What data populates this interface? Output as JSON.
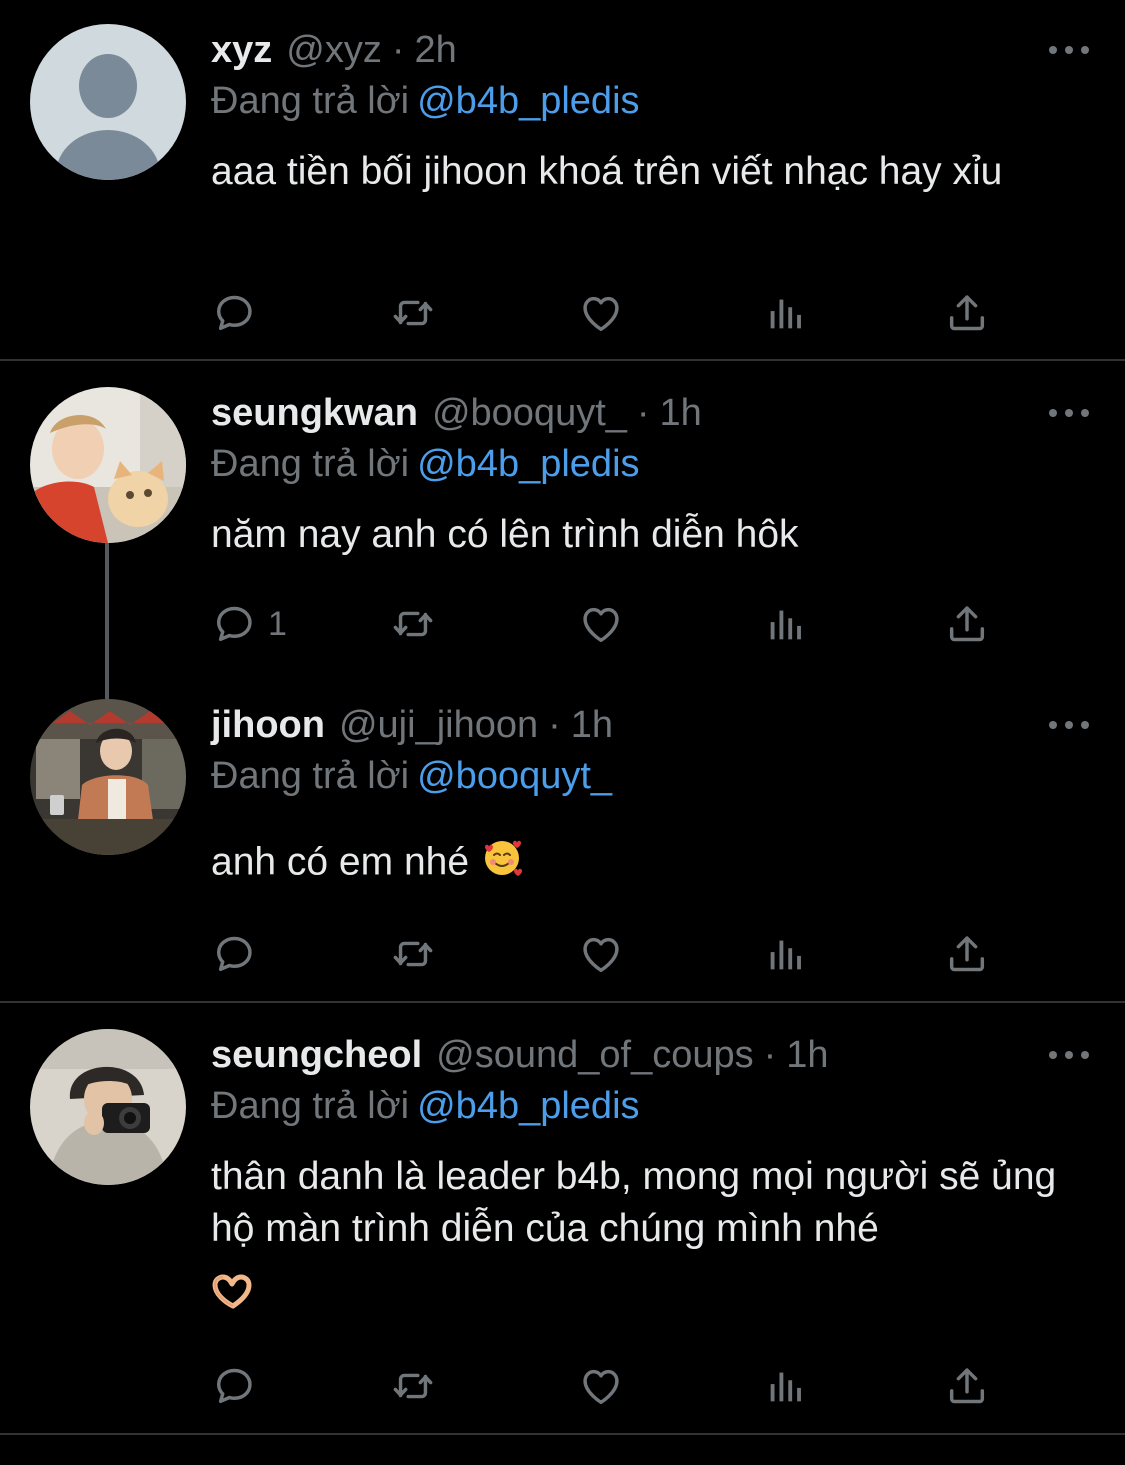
{
  "tweets": [
    {
      "name": "xyz",
      "handle": "@xyz",
      "dot": "·",
      "time": "2h",
      "reply_prefix": "Đang trả lời",
      "reply_to": "@b4b_pledis",
      "text": "aaa tiền bối jihoon khoá trên viết nhạc hay xỉu",
      "reply_count": "",
      "avatar": "default-avatar-icon"
    },
    {
      "name": "seungkwan",
      "handle": "@booquyt_",
      "dot": "·",
      "time": "1h",
      "reply_prefix": "Đang trả lời",
      "reply_to": "@b4b_pledis",
      "text": "năm nay anh có lên trình diễn hôk",
      "reply_count": "1",
      "avatar": "photo-avatar-with-cat"
    },
    {
      "name": "jihoon",
      "handle": "@uji_jihoon",
      "dot": "·",
      "time": "1h",
      "reply_prefix": "Đang trả lời",
      "reply_to": "@booquyt_",
      "text": "anh có em nhé",
      "reply_count": "",
      "emoji": "smiling-face-with-hearts-emoji",
      "avatar": "photo-avatar-room"
    },
    {
      "name": "seungcheol",
      "handle": "@sound_of_coups",
      "dot": "·",
      "time": "1h",
      "reply_prefix": "Đang trả lời",
      "reply_to": "@b4b_pledis",
      "text": "thân danh là leader b4b, mong mọi người sẽ ủng hộ màn trình diễn của chúng mình nhé",
      "reply_count": "",
      "emoji": "heart-hands-emoji",
      "avatar": "photo-avatar-camera"
    }
  ],
  "colors": {
    "background": "#000000",
    "primary_text": "#e7e9ea",
    "secondary_text": "#71767b",
    "mention": "#4c9eeb",
    "divider": "#2f3336"
  },
  "icons": [
    "reply-icon",
    "retweet-icon",
    "like-icon",
    "views-icon",
    "share-icon",
    "more-icon"
  ]
}
